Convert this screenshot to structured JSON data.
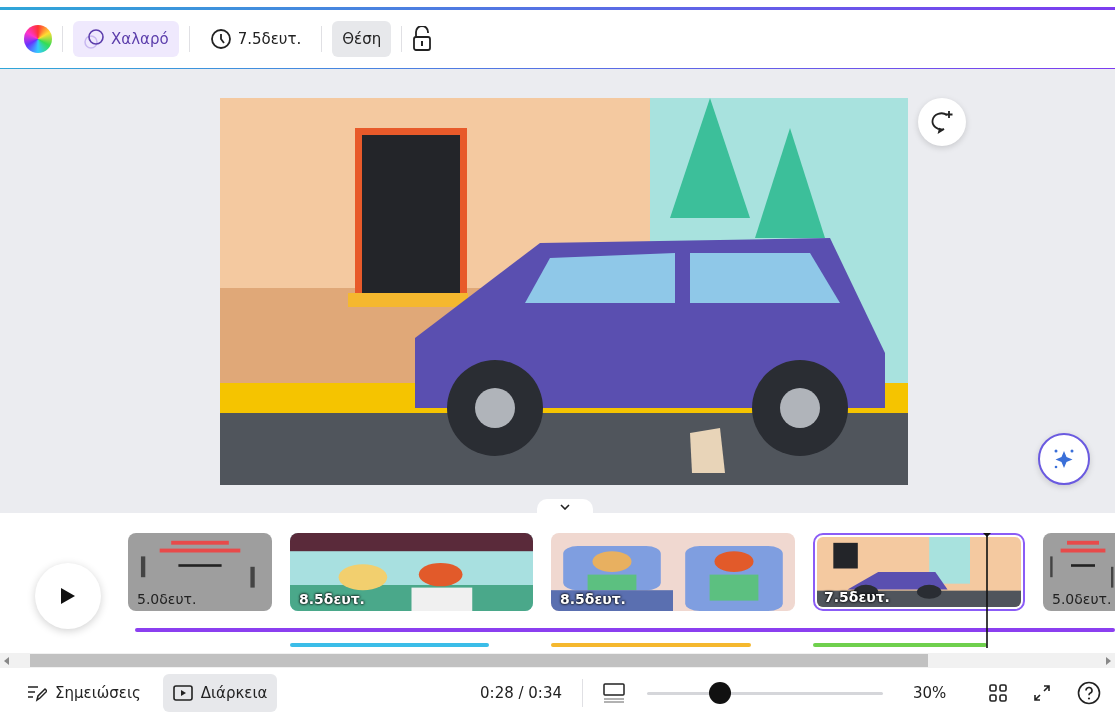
{
  "toolbar": {
    "animation": {
      "label": "Χαλαρό",
      "active": true
    },
    "duration": "7.5δευτ.",
    "position": {
      "label": "Θέση",
      "active": true
    }
  },
  "timeline": {
    "clips": [
      {
        "kind": "slide",
        "duration": "5.0δευτ.",
        "selected": false
      },
      {
        "kind": "scene",
        "duration": "8.5δευτ.",
        "selected": false,
        "color": "#3bbde8"
      },
      {
        "kind": "scene",
        "duration": "8.5δευτ.",
        "selected": false,
        "color": "#f5b82e"
      },
      {
        "kind": "scene",
        "duration": "7.5δευτ.",
        "selected": true,
        "color": "#6fd04d"
      },
      {
        "kind": "slide",
        "duration": "5.0δευτ.",
        "selected": false
      }
    ],
    "playhead": {
      "level": 0.87
    }
  },
  "footer": {
    "notes": "Σημειώσεις",
    "duration_button": {
      "label": "Διάρκεια",
      "selected": true
    },
    "time": "0:28 / 0:34",
    "zoom": {
      "level": 0.31
    },
    "zoom_reading": "30%"
  }
}
